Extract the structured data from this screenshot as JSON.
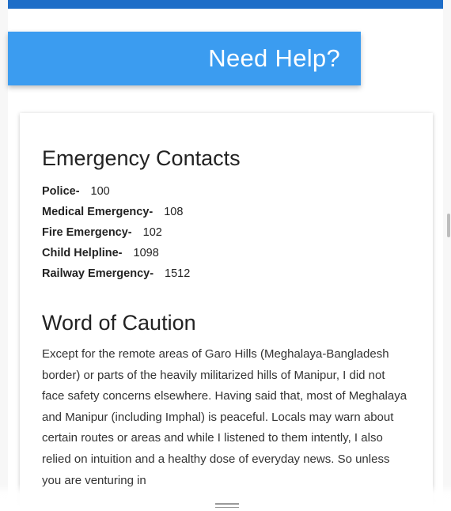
{
  "banner": {
    "title": "Need Help?"
  },
  "emergency": {
    "title": "Emergency Contacts",
    "contacts": [
      {
        "label": "Police-",
        "number": "100"
      },
      {
        "label": "Medical Emergency-",
        "number": "108"
      },
      {
        "label": "Fire Emergency-",
        "number": "102"
      },
      {
        "label": "Child Helpline-",
        "number": "1098"
      },
      {
        "label": "Railway Emergency-",
        "number": "1512"
      }
    ]
  },
  "caution": {
    "title": "Word of Caution",
    "body": "Except for the remote areas of Garo Hills (Meghalaya-Bangladesh border) or parts of the heavily militarized hills of Manipur, I did not face safety concerns elsewhere. Having said that, most of Meghalaya and Manipur (including Imphal) is peaceful. Locals may warn about certain routes or areas and while I listened to them intently, I also relied on intuition and a healthy dose of everyday news. So unless you are venturing in"
  },
  "colors": {
    "banner": "#3b9cf0",
    "top_bar": "#1e6ec8"
  },
  "icons": {
    "bottom": "drag-handle-icon"
  }
}
